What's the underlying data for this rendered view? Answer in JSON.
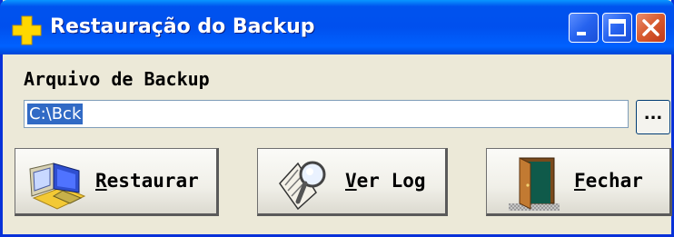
{
  "window": {
    "title": "Restauração do Backup"
  },
  "backup_file": {
    "label": "Arquivo de Backup",
    "value": "C:\\Bck",
    "browse_label": "..."
  },
  "buttons": {
    "restore": {
      "mnemonic": "R",
      "rest": "estaurar"
    },
    "view_log": {
      "mnemonic": "V",
      "rest": "er Log"
    },
    "close": {
      "mnemonic": "F",
      "rest": "echar"
    }
  },
  "icons": {
    "app": "yellow-plus-icon",
    "minimize": "minimize-icon",
    "maximize": "maximize-icon",
    "close": "close-icon",
    "restore": "computer-restore-icon",
    "view_log": "magnifier-document-icon",
    "exit": "open-door-icon"
  },
  "colors": {
    "titlebar": "#0053ee",
    "selection": "#316ac5",
    "window_bg": "#ece9d8",
    "close_button": "#d75a2e"
  }
}
